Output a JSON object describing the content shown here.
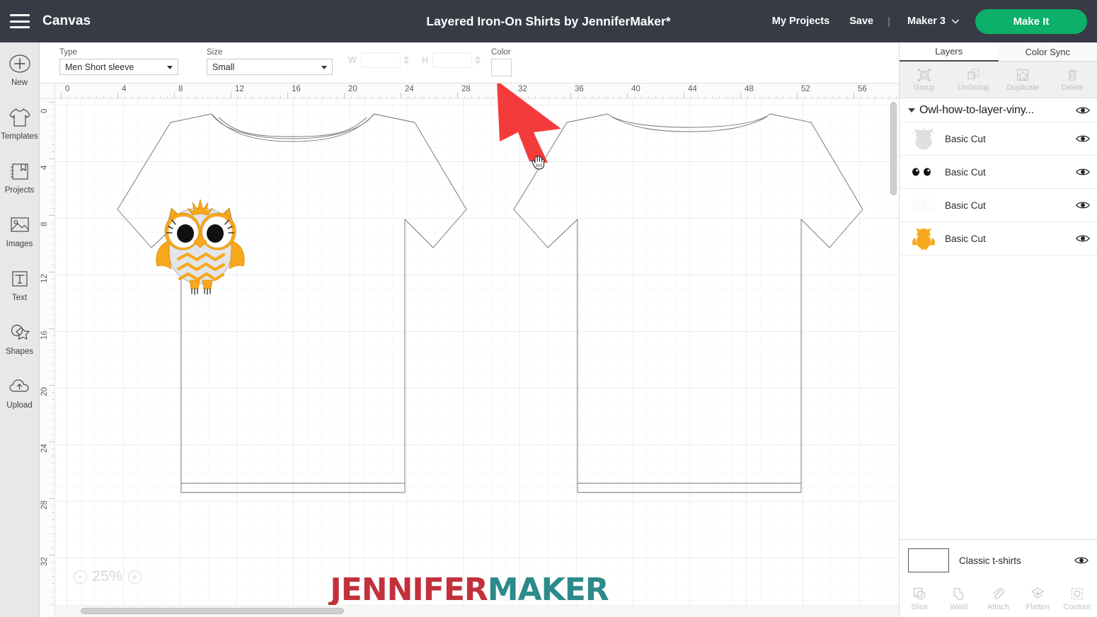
{
  "topbar": {
    "menu_icon": "hamburger-icon",
    "canvas_label": "Canvas",
    "document_title": "Layered Iron-On Shirts by JenniferMaker*",
    "my_projects": "My Projects",
    "save": "Save",
    "separator": "|",
    "machine": "Maker 3",
    "make_it": "Make It",
    "accent_green": "#0cb06a",
    "bar_color": "#373b45"
  },
  "sidebar": {
    "items": [
      {
        "label": "New",
        "icon": "plus-circle-icon"
      },
      {
        "label": "Templates",
        "icon": "tshirt-icon"
      },
      {
        "label": "Projects",
        "icon": "book-icon"
      },
      {
        "label": "Images",
        "icon": "image-icon"
      },
      {
        "label": "Text",
        "icon": "text-icon"
      },
      {
        "label": "Shapes",
        "icon": "shapes-icon"
      },
      {
        "label": "Upload",
        "icon": "upload-cloud-icon"
      }
    ]
  },
  "toolbar": {
    "type_label": "Type",
    "type_value": "Men Short sleeve",
    "size_label": "Size",
    "size_value": "Small",
    "width_label": "W",
    "width_value": "",
    "height_label": "H",
    "height_value": "",
    "lock_icon": "lock-icon",
    "color_label": "Color",
    "color_value": "#ffffff"
  },
  "canvas": {
    "ruler_h": [
      "0",
      "4",
      "8",
      "12",
      "16",
      "20",
      "24",
      "28",
      "32",
      "36",
      "40",
      "44",
      "48",
      "52",
      "56"
    ],
    "ruler_v": [
      "0",
      "4",
      "8",
      "12",
      "16",
      "20",
      "24",
      "28",
      "32"
    ],
    "zoom_level": "25%",
    "zoom_out": "−",
    "zoom_in": "+",
    "watermark_part1": "JENNIFER",
    "watermark_part2": "MAKER",
    "watermark_color1": "#c2313b",
    "watermark_color2": "#2b8a8a",
    "annotation": "red-arrow-pointing-to-color-swatch",
    "owl_colors": {
      "gold": "#f7a81b",
      "body": "#e3e5ea",
      "eye": "#111111",
      "white": "#ffffff"
    }
  },
  "right_panel": {
    "tabs": [
      {
        "label": "Layers",
        "active": true
      },
      {
        "label": "Color Sync",
        "active": false
      }
    ],
    "operations": [
      {
        "label": "Group",
        "icon": "group-icon",
        "enabled": false
      },
      {
        "label": "UnGroup",
        "icon": "ungroup-icon",
        "enabled": false
      },
      {
        "label": "Duplicate",
        "icon": "duplicate-icon",
        "enabled": false
      },
      {
        "label": "Delete",
        "icon": "trash-icon",
        "enabled": false
      }
    ],
    "group": {
      "name": "Owl-how-to-layer-viny...",
      "visibility_icon": "eye-icon"
    },
    "layers": [
      {
        "name": "Basic Cut",
        "thumb": "owl-body-grey",
        "visibility_icon": "eye-icon"
      },
      {
        "name": "Basic Cut",
        "thumb": "owl-eyes-black",
        "visibility_icon": "eye-icon"
      },
      {
        "name": "Basic Cut",
        "thumb": "owl-eyes-white",
        "visibility_icon": "eye-icon"
      },
      {
        "name": "Basic Cut",
        "thumb": "owl-body-gold",
        "visibility_icon": "eye-icon"
      }
    ],
    "template_row": {
      "name": "Classic t-shirts",
      "swatch_color": "#ffffff",
      "visibility_icon": "eye-icon"
    },
    "actions": [
      {
        "label": "Slice",
        "icon": "slice-icon",
        "enabled": false
      },
      {
        "label": "Weld",
        "icon": "weld-icon",
        "enabled": false
      },
      {
        "label": "Attach",
        "icon": "paperclip-icon",
        "enabled": false
      },
      {
        "label": "Flatten",
        "icon": "flatten-icon",
        "enabled": false
      },
      {
        "label": "Contour",
        "icon": "contour-icon",
        "enabled": false
      }
    ]
  }
}
